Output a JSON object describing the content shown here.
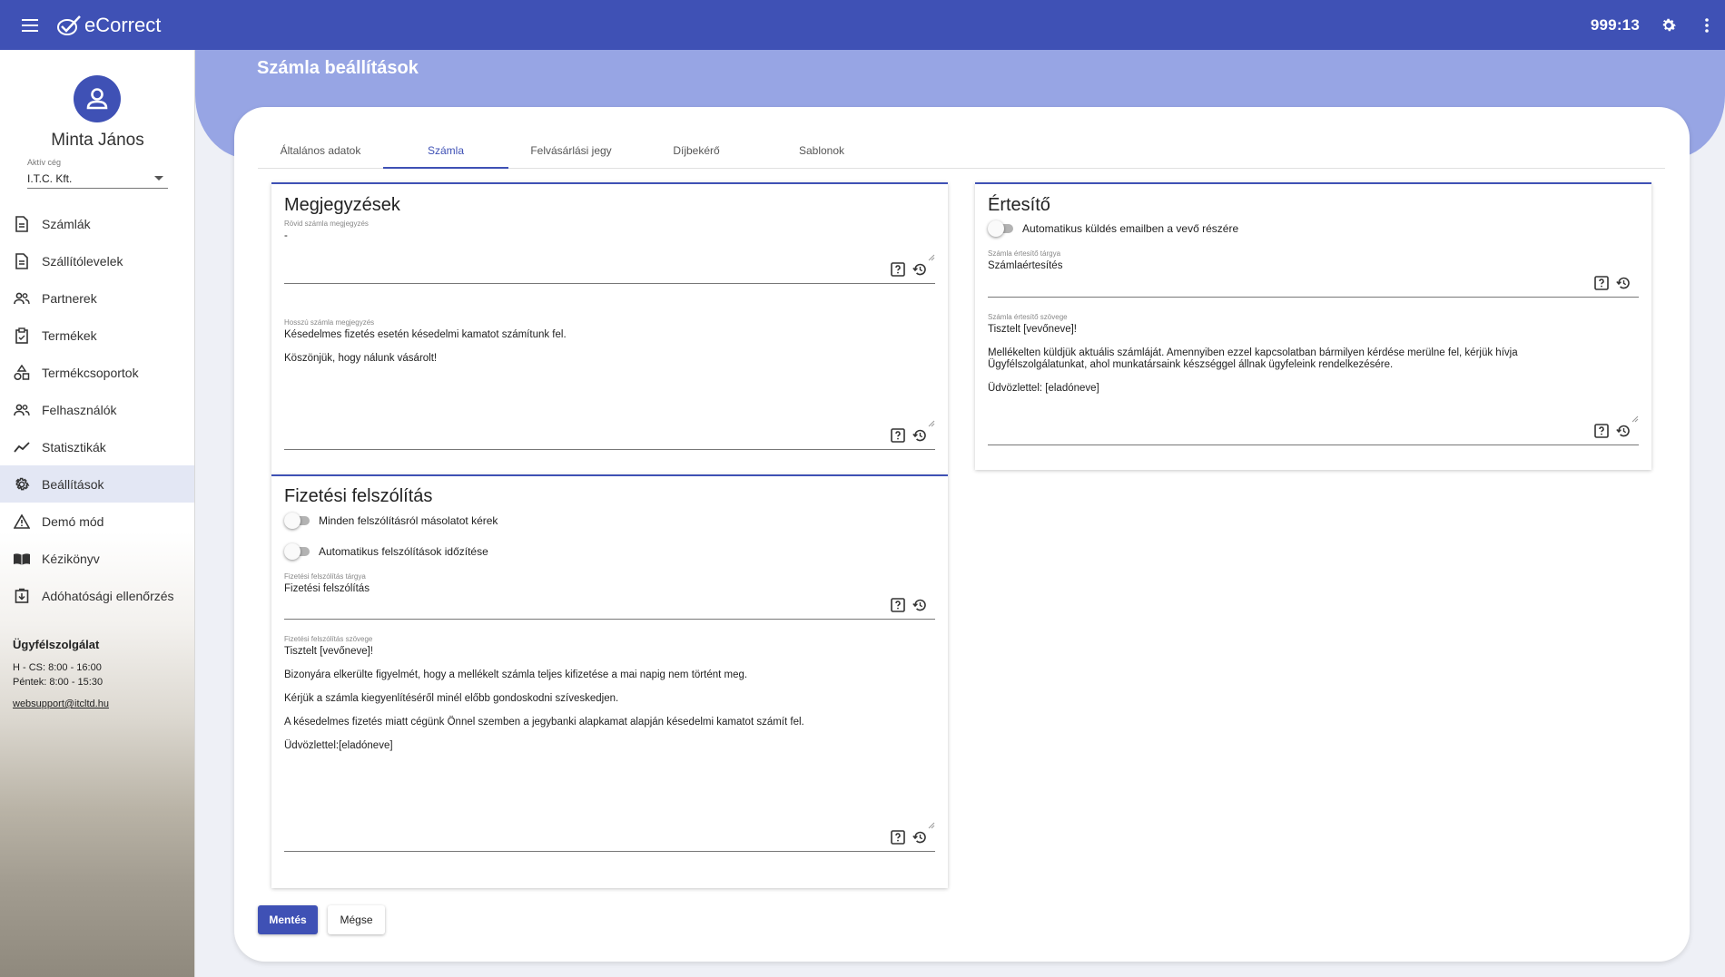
{
  "topbar": {
    "app_name": "eCorrect",
    "timer": "999:13",
    "menu_icon": "menu-icon",
    "settings_icon": "gear-icon",
    "more_icon": "more-vertical-icon"
  },
  "sidebar": {
    "user_name": "Minta János",
    "company_label": "Aktív cég",
    "company_value": "I.T.C. Kft.",
    "items": [
      {
        "label": "Számlák",
        "icon": "document-icon"
      },
      {
        "label": "Szállítólevelek",
        "icon": "document-icon"
      },
      {
        "label": "Partnerek",
        "icon": "people-icon"
      },
      {
        "label": "Termékek",
        "icon": "clipboard-icon"
      },
      {
        "label": "Termékcsoportok",
        "icon": "shapes-icon"
      },
      {
        "label": "Felhasználók",
        "icon": "people-icon"
      },
      {
        "label": "Statisztikák",
        "icon": "trend-icon"
      },
      {
        "label": "Beállítások",
        "icon": "gear-icon"
      },
      {
        "label": "Demó mód",
        "icon": "warning-icon"
      },
      {
        "label": "Kézikönyv",
        "icon": "book-icon"
      },
      {
        "label": "Adóhatósági ellenőrzés",
        "icon": "download-box-icon"
      }
    ],
    "active_item": "Beállítások",
    "support": {
      "title": "Ügyfélszolgálat",
      "hours_1": "H - CS: 8:00 - 16:00",
      "hours_2": "Péntek: 8:00 - 15:30",
      "email": "websupport@itcltd.hu"
    }
  },
  "page": {
    "title": "Számla beállítások"
  },
  "tabs": [
    {
      "label": "Általános adatok"
    },
    {
      "label": "Számla"
    },
    {
      "label": "Felvásárlási jegy"
    },
    {
      "label": "Díjbekérő"
    },
    {
      "label": "Sablonok"
    }
  ],
  "active_tab": "Számla",
  "notes": {
    "title": "Megjegyzések",
    "short_label": "Rövid számla megjegyzés",
    "short_value": "-",
    "long_label": "Hosszú számla megjegyzés",
    "long_lines": [
      "Késedelmes fizetés esetén késedelmi kamatot számítunk fel.",
      "Köszönjük, hogy nálunk vásárolt!"
    ]
  },
  "payment_reminder": {
    "title": "Fizetési felszólítás",
    "toggle_copy": "Minden felszólításról másolatot kérek",
    "toggle_auto": "Automatikus felszólítások időzítése",
    "subject_label": "Fizetési felszólítás tárgya",
    "subject_value": "Fizetési felszólítás",
    "body_label": "Fizetési felszólítás szövege",
    "body_lines": [
      "Tisztelt [vevőneve]!",
      "Bizonyára elkerülte figyelmét, hogy a mellékelt számla teljes kifizetése a mai napig nem történt meg.",
      "Kérjük a számla kiegyenlítéséről minél előbb gondoskodni szíveskedjen.",
      "A késedelmes fizetés miatt cégünk Önnel szemben a jegybanki alapkamat alapján késedelmi kamatot számít fel.",
      "Üdvözlettel:[eladóneve]"
    ]
  },
  "notifier": {
    "title": "Értesítő",
    "toggle_auto_email": "Automatikus küldés emailben a vevő részére",
    "subject_label": "Számla értesítő tárgya",
    "subject_value": "Számlaértesítés",
    "body_label": "Számla értesítő szövege",
    "body_lines": [
      "Tisztelt [vevőneve]!",
      "Mellékelten küldjük aktuális számláját. Amennyiben ezzel kapcsolatban bármilyen kérdése merülne fel, kérjük hívja Ügyfélszolgálatunkat, ahol munkatársaink készséggel állnak ügyfeleink rendelkezésére.",
      "Üdvözlettel:  [eladóneve]"
    ]
  },
  "field_icons": {
    "help": "help-box-icon",
    "reset": "restore-icon"
  },
  "actions": {
    "save": "Mentés",
    "cancel": "Mégse"
  },
  "colors": {
    "primary": "#3f51b5",
    "banner": "#97a5e4"
  }
}
